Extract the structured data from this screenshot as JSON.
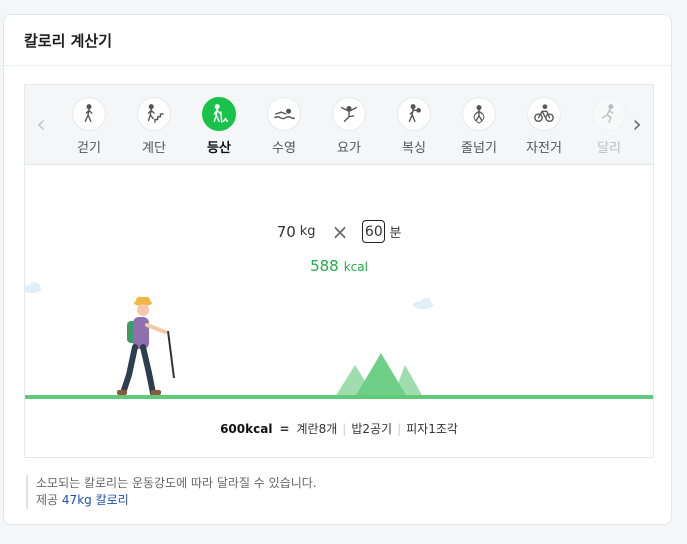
{
  "card": {
    "title": "칼로리 계산기"
  },
  "tabs": [
    {
      "label": "걷기",
      "icon": "walking-icon",
      "active": false
    },
    {
      "label": "계단",
      "icon": "stairs-icon",
      "active": false
    },
    {
      "label": "등산",
      "icon": "hiking-icon",
      "active": true
    },
    {
      "label": "수영",
      "icon": "swimming-icon",
      "active": false
    },
    {
      "label": "요가",
      "icon": "yoga-icon",
      "active": false
    },
    {
      "label": "복싱",
      "icon": "boxing-icon",
      "active": false
    },
    {
      "label": "줄넘기",
      "icon": "jump-rope-icon",
      "active": false
    },
    {
      "label": "자전거",
      "icon": "bicycle-icon",
      "active": false
    },
    {
      "label": "달리",
      "icon": "running-icon",
      "active": false
    }
  ],
  "calc": {
    "weight": "70",
    "weight_unit": "kg",
    "times": "×",
    "minutes": "60",
    "minutes_unit": "분",
    "result": "588",
    "result_unit": "kcal"
  },
  "equivalent": {
    "kcal": "600kcal",
    "eq": "=",
    "items": [
      "계란8개",
      "밥2공기",
      "피자1조각"
    ]
  },
  "note": {
    "text": "소모되는 칼로리는 운동강도에 따라 달라질 수 있습니다.",
    "provider_prefix": "제공",
    "provider_link": "47kg 칼로리"
  },
  "colors": {
    "accent": "#19c34a",
    "result": "#1fae48",
    "ground": "#5fca7a",
    "link": "#1f4fb4"
  }
}
